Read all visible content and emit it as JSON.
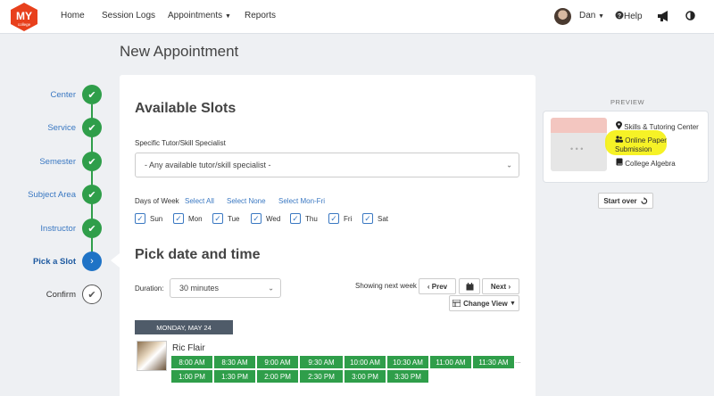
{
  "brand": {
    "logo_text": "MY",
    "logo_sub": "college",
    "color": "#e8401c"
  },
  "nav": {
    "home": "Home",
    "session_logs": "Session Logs",
    "appointments": "Appointments",
    "reports": "Reports",
    "user": "Dan",
    "help": "Help"
  },
  "page": {
    "title": "New Appointment"
  },
  "stepper": {
    "steps": [
      {
        "label": "Center",
        "state": "done"
      },
      {
        "label": "Service",
        "state": "done"
      },
      {
        "label": "Semester",
        "state": "done"
      },
      {
        "label": "Subject Area",
        "state": "done"
      },
      {
        "label": "Instructor",
        "state": "done"
      },
      {
        "label": "Pick a Slot",
        "state": "active"
      },
      {
        "label": "Confirm",
        "state": "todo"
      }
    ]
  },
  "slots": {
    "title": "Available Slots",
    "tutor_label": "Specific Tutor/Skill Specialist",
    "tutor_value": "- Any available tutor/skill specialist -",
    "days_label": "Days of Week",
    "select_all": "Select All",
    "select_none": "Select None",
    "select_weekdays": "Select Mon-Fri",
    "days": [
      {
        "label": "Sun",
        "checked": true
      },
      {
        "label": "Mon",
        "checked": true
      },
      {
        "label": "Tue",
        "checked": true
      },
      {
        "label": "Wed",
        "checked": true
      },
      {
        "label": "Thu",
        "checked": true
      },
      {
        "label": "Fri",
        "checked": true
      },
      {
        "label": "Sat",
        "checked": true
      }
    ]
  },
  "picker": {
    "title": "Pick date and time",
    "duration_label": "Duration:",
    "duration_value": "30 minutes",
    "showing_label": "Showing next week",
    "prev": "Prev",
    "next": "Next",
    "change_view": "Change View",
    "date_header": "MONDAY, MAY 24",
    "tutor_name": "Ric Flair",
    "times_row1": [
      "8:00 AM",
      "8:30 AM",
      "9:00 AM",
      "9:30 AM",
      "10:00 AM",
      "10:30 AM",
      "11:00 AM",
      "11:30 AM"
    ],
    "times_row2": [
      "1:00 PM",
      "1:30 PM",
      "2:00 PM",
      "2:30 PM",
      "3:00 PM",
      "3:30 PM"
    ],
    "more": "..."
  },
  "preview": {
    "label": "PREVIEW",
    "center": "Skills & Tutoring Center",
    "service": "Online Paper Submission",
    "subject": "College Algebra",
    "start_over": "Start over"
  },
  "colors": {
    "success": "#2f9e4a",
    "primary": "#1f73c6",
    "link": "#3a78c2",
    "highlight": "#f4f000"
  }
}
